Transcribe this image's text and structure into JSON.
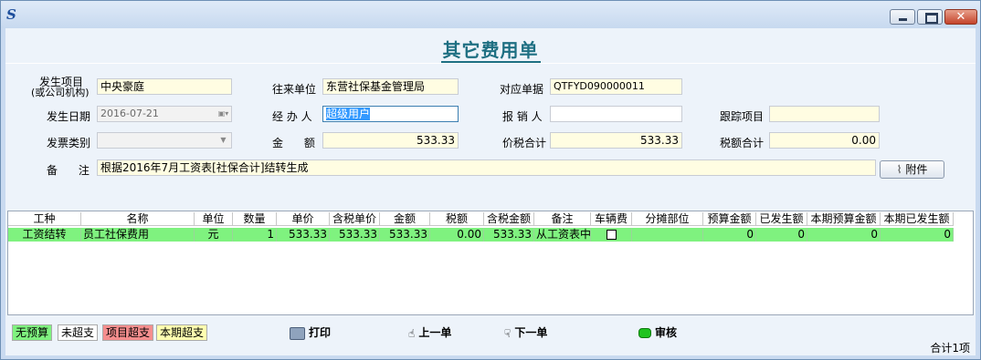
{
  "window": {
    "title_icon": "app-logo-icon"
  },
  "page": {
    "title": "其它费用单"
  },
  "form": {
    "project_label_1": "发生项目",
    "project_label_2": "(或公司机构)",
    "project": "中央豪庭",
    "partner_label": "往来单位",
    "partner": "东营社保基金管理局",
    "ref_label": "对应单据",
    "ref": "QTFYD090000011",
    "date_label": "发生日期",
    "date": "2016-07-21",
    "handler_label": "经 办 人",
    "handler": "超级用户",
    "reimburser_label": "报 销 人",
    "reimburser": "",
    "tracking_label": "跟踪项目",
    "tracking": "",
    "invoice_label": "发票类别",
    "invoice": "",
    "amount_label": "金      额",
    "amount": "533.33",
    "tax_total_price_label": "价税合计",
    "tax_total_price": "533.33",
    "tax_sum_label": "税额合计",
    "tax_sum": "0.00",
    "remark_label": "备      注",
    "remark": "根据2016年7月工资表[社保合计]结转生成",
    "attach_label": "附件"
  },
  "grid": {
    "headers": [
      "工种",
      "名称",
      "单位",
      "数量",
      "单价",
      "含税单价",
      "金额",
      "税额",
      "含税金额",
      "备注",
      "车辆费",
      "分摊部位",
      "预算金额",
      "已发生额",
      "本期预算金额",
      "本期已发生额"
    ],
    "rows": [
      [
        "工资结转",
        "员工社保费用",
        "元",
        "1",
        "533.33",
        "533.33",
        "533.33",
        "0.00",
        "533.33",
        "从工资表中",
        "",
        "",
        "0",
        "0",
        "0",
        "0"
      ]
    ]
  },
  "legend": [
    {
      "label": "无预算",
      "color": "#7ff27f"
    },
    {
      "label": "未超支",
      "color": "#ffffff"
    },
    {
      "label": "项目超支",
      "color": "#f58e8e"
    },
    {
      "label": "本期超支",
      "color": "#ffffb0"
    }
  ],
  "toolbar": {
    "print": "打印",
    "prev": "上一单",
    "next": "下一单",
    "approve": "审核"
  },
  "status": {
    "total": "合计1项"
  }
}
